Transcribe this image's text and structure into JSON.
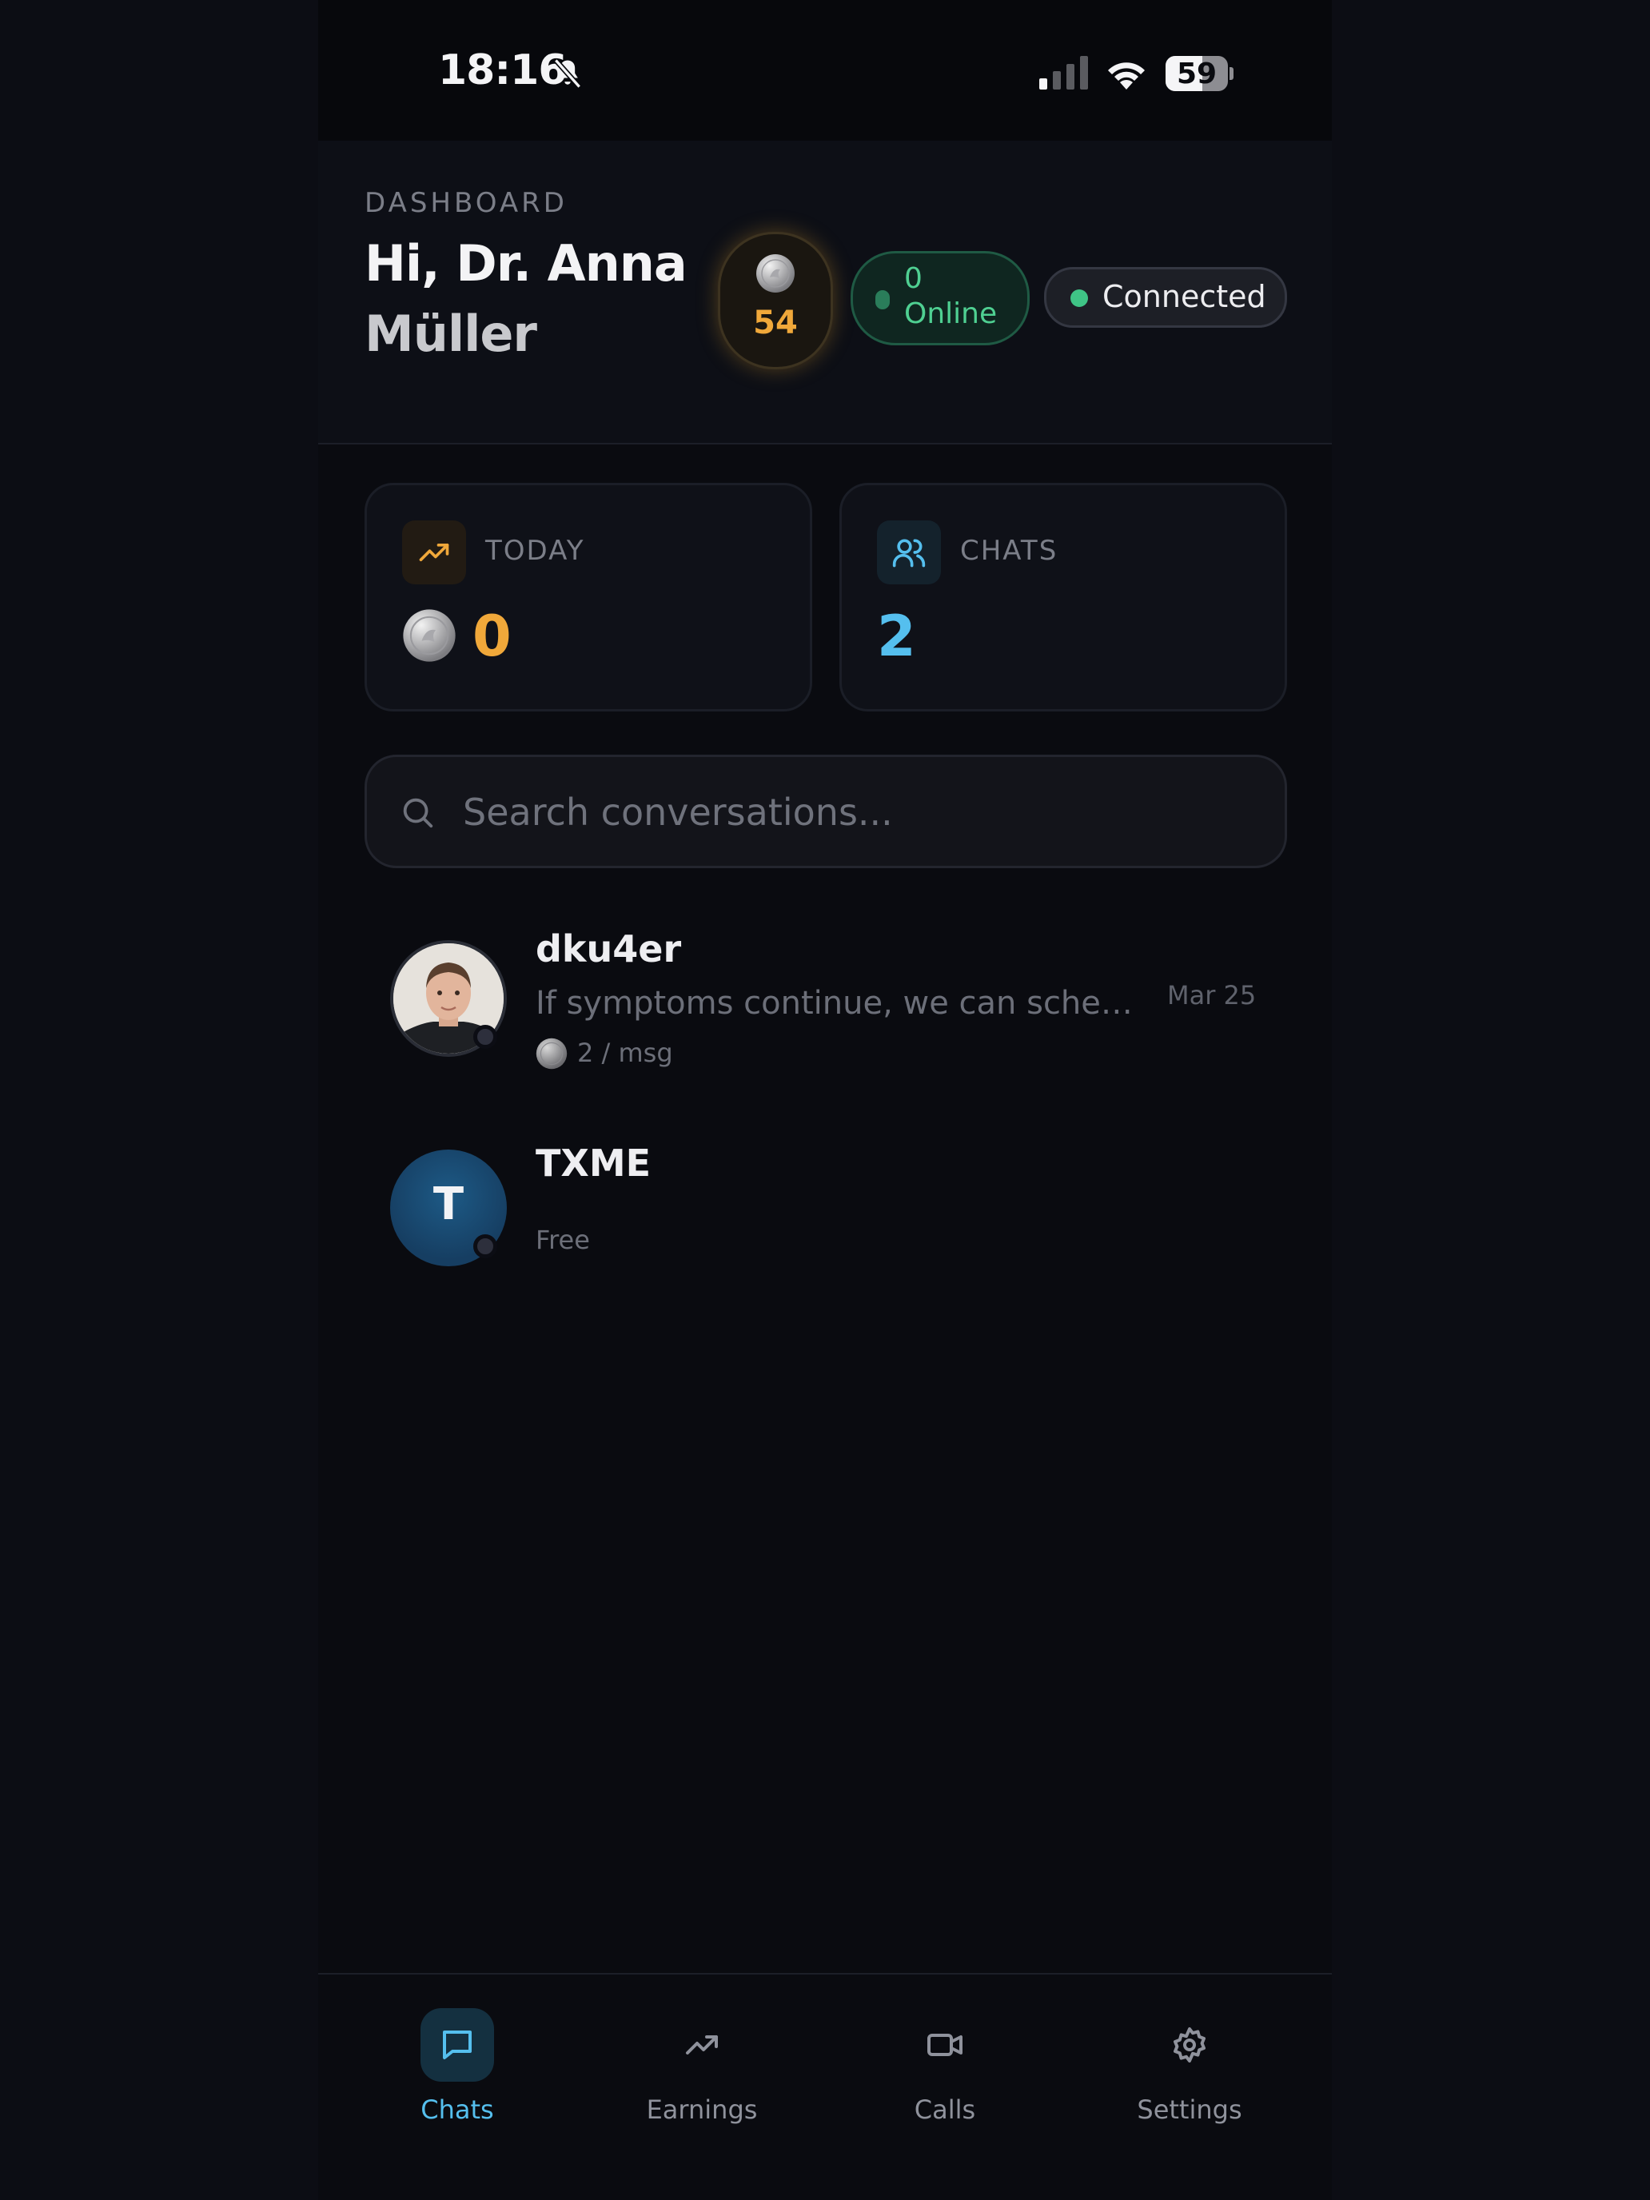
{
  "status_bar": {
    "time": "18:16",
    "battery_level": "59",
    "battery_fraction": 0.59,
    "icons": [
      "bell-slash-icon",
      "cellular-signal-icon",
      "wifi-icon",
      "battery-icon"
    ]
  },
  "header": {
    "eyebrow": "DASHBOARD",
    "greeting_line1": "Hi, Dr. Anna",
    "greeting_line2": "Müller",
    "coin_balance": "54",
    "online_count": "0",
    "online_label": "Online",
    "connection_status": "Connected"
  },
  "stats": [
    {
      "label": "TODAY",
      "value": "0",
      "icon": "trending-up-icon",
      "color": "#f0a83a"
    },
    {
      "label": "CHATS",
      "value": "2",
      "icon": "users-icon",
      "color": "#55bfee"
    }
  ],
  "search": {
    "placeholder": "Search conversations..."
  },
  "conversations": [
    {
      "name": "dku4er",
      "preview": "If symptoms continue, we can schedul...",
      "price": "2 / msg",
      "date": "Mar 25"
    },
    {
      "name": "TXME",
      "initial": "T",
      "price": "Free"
    }
  ],
  "bottom_nav": [
    {
      "label": "Chats",
      "icon": "chat-bubble-icon",
      "active": true
    },
    {
      "label": "Earnings",
      "icon": "trending-up-icon",
      "active": false
    },
    {
      "label": "Calls",
      "icon": "video-camera-icon",
      "active": false
    },
    {
      "label": "Settings",
      "icon": "gear-icon",
      "active": false
    }
  ],
  "colors": {
    "accent_blue": "#55bfee",
    "accent_gold": "#f0a83a",
    "online_green": "#4fd092",
    "background": "#0a0b10"
  }
}
